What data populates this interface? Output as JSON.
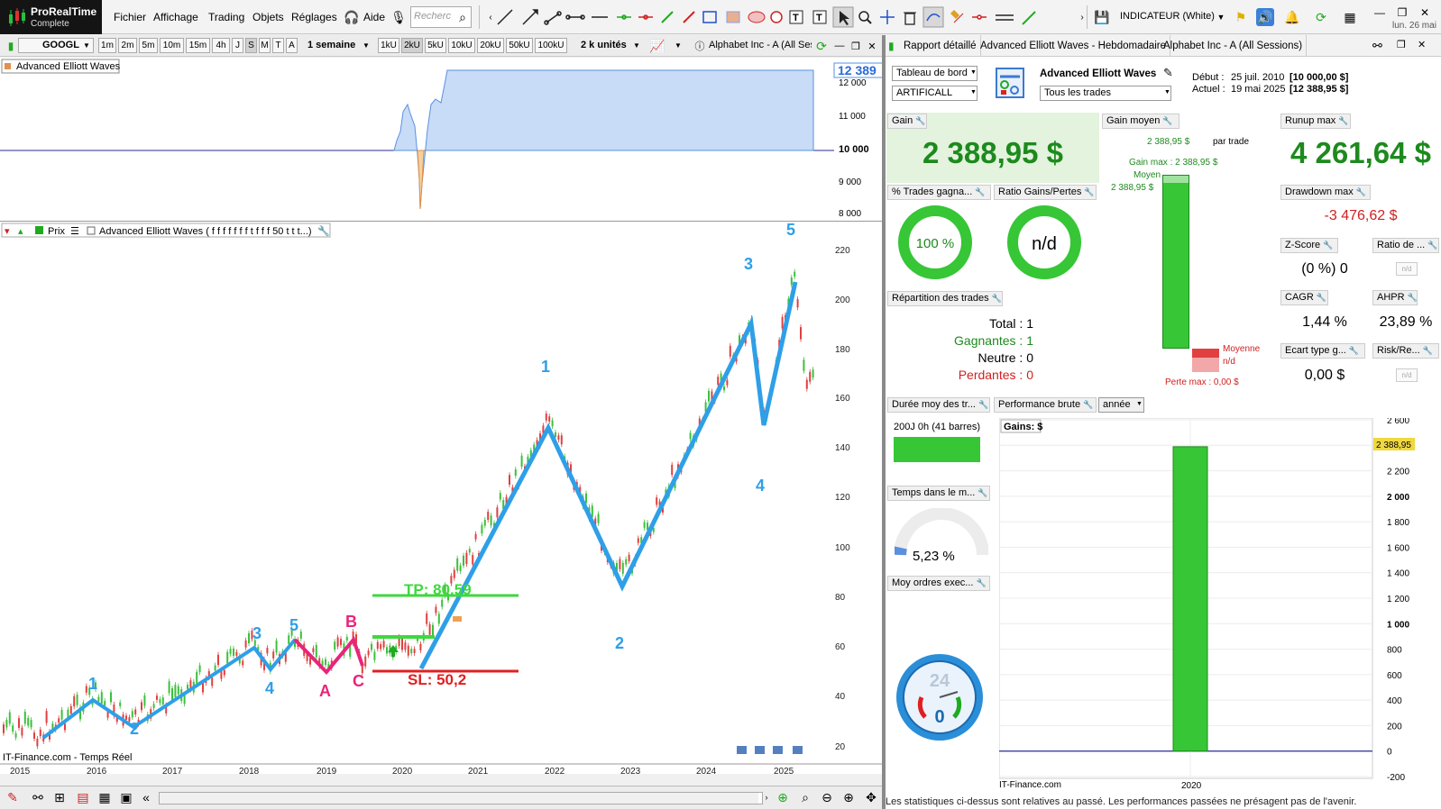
{
  "app": {
    "name": "ProRealTime",
    "edition": "Complete",
    "date": "lun. 26 mai"
  },
  "menu": [
    "Fichier",
    "Affichage",
    "Trading",
    "Objets",
    "Réglages",
    "Aide"
  ],
  "search": {
    "placeholder": "Recherc"
  },
  "indicator_label": "INDICATEUR (White)",
  "toolbar2": {
    "symbol": "GOOGL",
    "timeframes": [
      "1m",
      "2m",
      "5m",
      "10m",
      "15m",
      "4h",
      "J",
      "S",
      "M",
      "T",
      "A"
    ],
    "period": "1 semaine",
    "units": [
      "1kU",
      "2kU",
      "5kU",
      "10kU",
      "20kU",
      "50kU",
      "100kU"
    ],
    "units_count": "2 k unités",
    "instrument": "Alphabet Inc - A (All Ses"
  },
  "equity_chart": {
    "label": "Advanced Elliott Waves",
    "badge": "12 389",
    "ticks": [
      "12 000",
      "11 000",
      "10 000",
      "9 000",
      "8 000"
    ]
  },
  "price_chart": {
    "legend_prix": "Prix",
    "legend_aew": "Advanced Elliott Waves ( f f f f f f f t f f f 50 t t t...)",
    "y_ticks": [
      "220",
      "200",
      "180",
      "160",
      "140",
      "120",
      "100",
      "80",
      "60",
      "40",
      "20"
    ],
    "x_ticks": [
      "2015",
      "2016",
      "2017",
      "2018",
      "2019",
      "2020",
      "2021",
      "2022",
      "2023",
      "2024",
      "2025"
    ],
    "wave_labels": {
      "w1a": "1",
      "w2a": "2",
      "w3a": "3",
      "w4a": "4",
      "w5a": "5",
      "wA": "A",
      "wB": "B",
      "wC": "C",
      "W1": "1",
      "W2": "2",
      "W3": "3",
      "W4": "4",
      "W5": "5"
    },
    "tp": "TP: 80,59",
    "sl": "SL: 50,2",
    "source": "IT-Finance.com - Temps Réel"
  },
  "report": {
    "tabs": [
      "Rapport détaillé",
      "Advanced Elliott Waves - Hebdomadaire",
      "Alphabet Inc - A (All Sessions)"
    ],
    "dashboard_select": "Tableau de bord",
    "account_select": "ARTIFICALL",
    "strategy_name": "Advanced Elliott Waves",
    "trades_select": "Tous les trades",
    "start_label": "Début :",
    "start_date": "25 juil. 2010",
    "start_value": "[10 000,00 $]",
    "current_label": "Actuel :",
    "current_date": "19 mai 2025",
    "current_value": "[12 388,95 $]",
    "gain_label": "Gain",
    "gain_value": "2 388,95 $",
    "gain_moyen_label": "Gain moyen",
    "gain_moyen_value": "2 388,95 $",
    "par_trade": "par trade",
    "gain_max": "Gain max : 2 388,95 $",
    "moyen": "Moyen",
    "moyen_value": "2 388,95 $",
    "moyenne": "Moyenne",
    "moyenne_value": "n/d",
    "perte_max": "Perte max : 0,00 $",
    "runup_label": "Runup max",
    "runup_value": "4 261,64 $",
    "drawdown_label": "Drawdown max",
    "drawdown_value": "-3 476,62 $",
    "zscore_label": "Z-Score",
    "zscore_value": "(0 %) 0",
    "ratio_label": "Ratio de ...",
    "nd": "n/d",
    "cagr_label": "CAGR",
    "cagr_value": "1,44 %",
    "ahpr_label": "AHPR",
    "ahpr_value": "23,89 %",
    "ecart_label": "Ecart type g...",
    "ecart_value": "0,00 $",
    "riskre_label": "Risk/Re...",
    "pct_trades_label": "% Trades gagna...",
    "pct_trades_value": "100 %",
    "ratio_gp_label": "Ratio Gains/Pertes",
    "ratio_gp_value": "n/d",
    "repartition_label": "Répartition des trades",
    "total_label": "Total :",
    "total_value": "1",
    "gagnantes_label": "Gagnantes :",
    "gagnantes_value": "1",
    "neutre_label": "Neutre :",
    "neutre_value": "0",
    "perdantes_label": "Perdantes :",
    "perdantes_value": "0",
    "duree_label": "Durée moy des tr...",
    "duree_value": "200J 0h (41 barres)",
    "temps_label": "Temps dans le m...",
    "temps_value": "5,23 %",
    "moy_ordres_label": "Moy ordres exec...",
    "perf_label": "Performance brute",
    "perf_period": "année",
    "gains_title": "Gains: $",
    "gains_ticks": [
      "2 600",
      "2 400",
      "2 200",
      "2 000",
      "1 800",
      "1 600",
      "1 400",
      "1 200",
      "1 000",
      "800",
      "600",
      "400",
      "200",
      "0",
      "-200"
    ],
    "gains_badge": "2 388,95",
    "gains_x": "2020",
    "gains_source": "IT-Finance.com",
    "clock_top": "24",
    "clock_mid": "0",
    "note": "Les statistiques ci-dessus sont relatives au passé. Les performances passées ne présagent pas de l'avenir."
  },
  "chart_data": {
    "type": "bar",
    "categories": [
      "2020"
    ],
    "values": [
      2388.95
    ],
    "title": "Gains: $",
    "ylim": [
      -200,
      2600
    ]
  },
  "colors": {
    "accent": "#2f9fe8",
    "gain": "#1d8a1d",
    "loss": "#e0403c",
    "pink": "#e8257a"
  }
}
